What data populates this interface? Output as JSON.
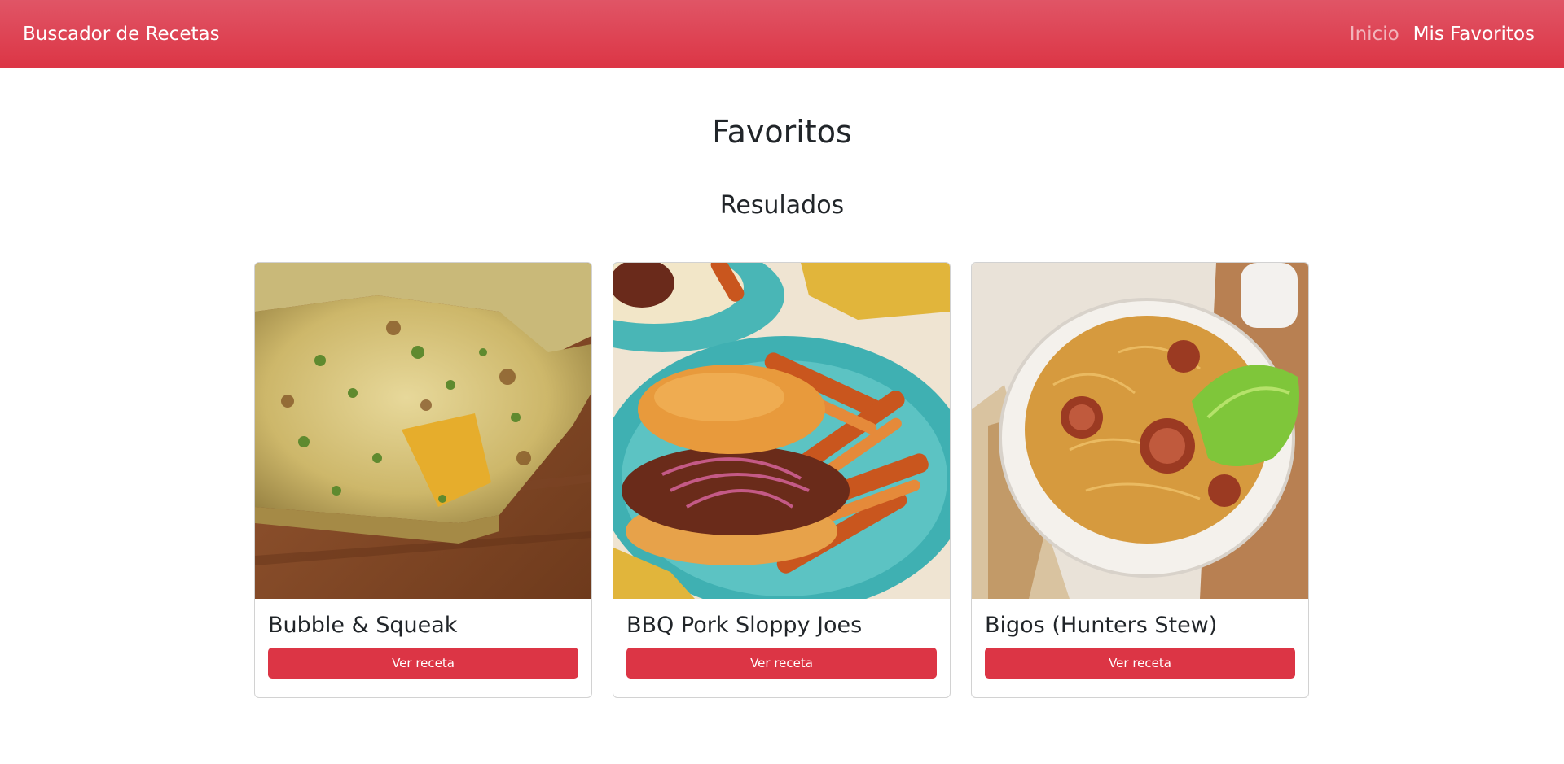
{
  "navbar": {
    "brand": "Buscador de Recetas",
    "links": [
      {
        "label": "Inicio"
      },
      {
        "label": "Mis Favoritos"
      }
    ]
  },
  "page": {
    "title": "Favoritos",
    "results_heading": "Resulados"
  },
  "recipes": [
    {
      "title": "Bubble & Squeak",
      "button": "Ver receta",
      "image": "baked vegetable frittata slice on wooden board"
    },
    {
      "title": "BBQ Pork Sloppy Joes",
      "button": "Ver receta",
      "image": "sloppy joe burger with sweet potato fries on teal plate"
    },
    {
      "title": "Bigos (Hunters Stew)",
      "button": "Ver receta",
      "image": "cabbage and sausage stew in white bowl with bread"
    }
  ],
  "colors": {
    "primary": "#dc3545",
    "navbar_top": "#e05566",
    "text": "#212529"
  }
}
